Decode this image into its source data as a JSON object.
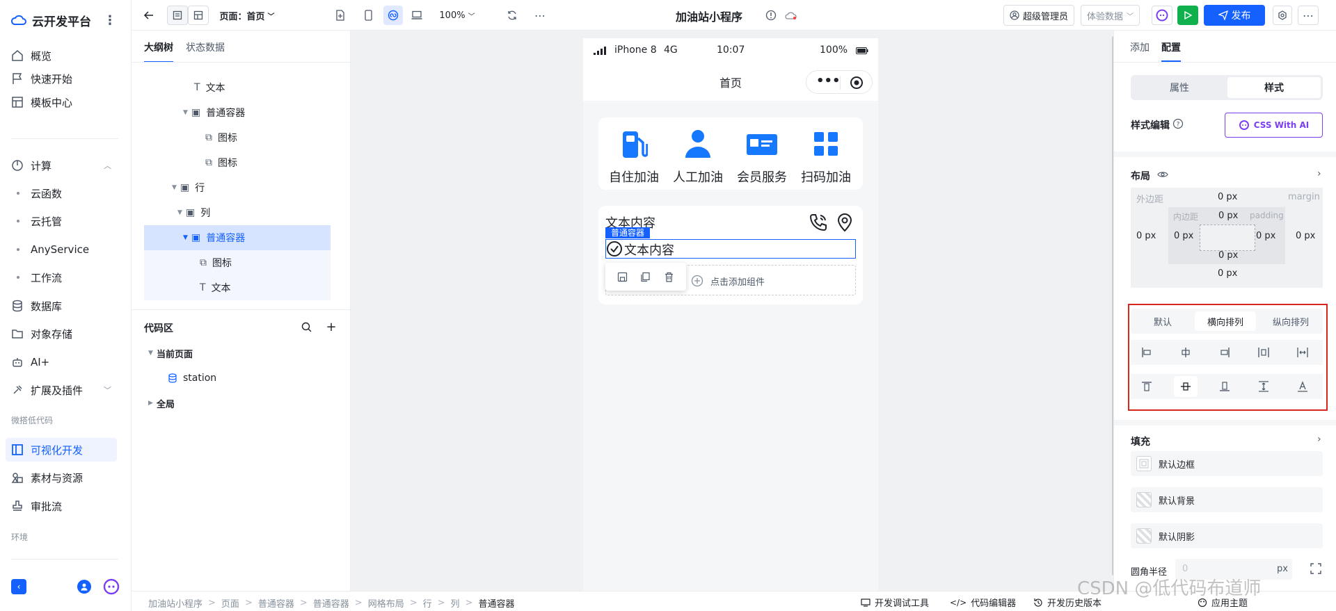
{
  "brand": {
    "name": "云开发平台"
  },
  "nav": {
    "items": [
      {
        "label": "概览"
      },
      {
        "label": "快速开始"
      },
      {
        "label": "模板中心"
      }
    ],
    "compute": {
      "label": "计算",
      "children": [
        "云函数",
        "云托管",
        "AnyService",
        "工作流"
      ]
    },
    "items2": [
      {
        "label": "数据库"
      },
      {
        "label": "对象存储"
      },
      {
        "label": "AI+"
      },
      {
        "label": "扩展及插件"
      }
    ],
    "group_lowcode": "微搭低代码",
    "lowcode": [
      {
        "label": "可视化开发"
      },
      {
        "label": "素材与资源"
      },
      {
        "label": "审批流"
      }
    ],
    "group_env": "环境"
  },
  "toolbar": {
    "page_label": "页面：首页",
    "zoom": "100%",
    "app_title": "加油站小程序",
    "admin": "超级管理员",
    "data_mode": "体验数据",
    "publish": "发布"
  },
  "outline": {
    "tabs": [
      "大纲树",
      "状态数据"
    ],
    "rows": [
      {
        "label": "文本",
        "icon": "text"
      },
      {
        "label": "普通容器",
        "icon": "box"
      },
      {
        "label": "图标",
        "icon": "shape"
      },
      {
        "label": "图标",
        "icon": "shape"
      },
      {
        "label": "行",
        "icon": "box"
      },
      {
        "label": "列",
        "icon": "box"
      },
      {
        "label": "普通容器",
        "icon": "box"
      },
      {
        "label": "图标",
        "icon": "shape"
      },
      {
        "label": "文本",
        "icon": "text"
      }
    ],
    "code_area": "代码区",
    "current_page": "当前页面",
    "station": "station",
    "global": "全局"
  },
  "phone": {
    "carrier": "iPhone 8",
    "network": "4G",
    "time": "10:07",
    "battery": "100%",
    "nav_title": "首页",
    "quick_items": [
      {
        "label": "自住加油",
        "icon": "fuel-pump-icon"
      },
      {
        "label": "人工加油",
        "icon": "person-icon"
      },
      {
        "label": "会员服务",
        "icon": "member-card-icon"
      },
      {
        "label": "扫码加油",
        "icon": "grid-icon"
      }
    ],
    "text_content": "文本内容",
    "container_tag": "普通容器",
    "selected_text": "文本内容",
    "add_component": "点击添加组件"
  },
  "rpanel": {
    "tabs": [
      "添加",
      "配置"
    ],
    "segments": [
      "属性",
      "样式"
    ],
    "style_edit": "样式编辑",
    "css_ai": "CSS With AI",
    "layout": "布局",
    "margin_label": "外边距",
    "margin_en": "margin",
    "padding_label": "内边距",
    "padding_en": "padding",
    "px_value": "0 px",
    "layout_modes": [
      "默认",
      "横向排列",
      "纵向排列"
    ],
    "fill": "填充",
    "fill_rows": [
      "默认边框",
      "默认背景",
      "默认阴影"
    ],
    "radius_label": "圆角半径",
    "radius_value": "0",
    "radius_unit": "px"
  },
  "breadcrumb": [
    "加油站小程序",
    "页面",
    "普通容器",
    "普通容器",
    "网格布局",
    "行",
    "列",
    "普通容器"
  ],
  "bottom_tools": [
    "开发调试工具",
    "代码编辑器",
    "开发历史版本",
    "应用主题"
  ],
  "watermark": "CSDN @低代码布道师",
  "colors": {
    "accent": "#1461ff",
    "publish_bg": "#1461ff",
    "run_bg": "#10b14d",
    "highlight_border": "#d9261c"
  }
}
